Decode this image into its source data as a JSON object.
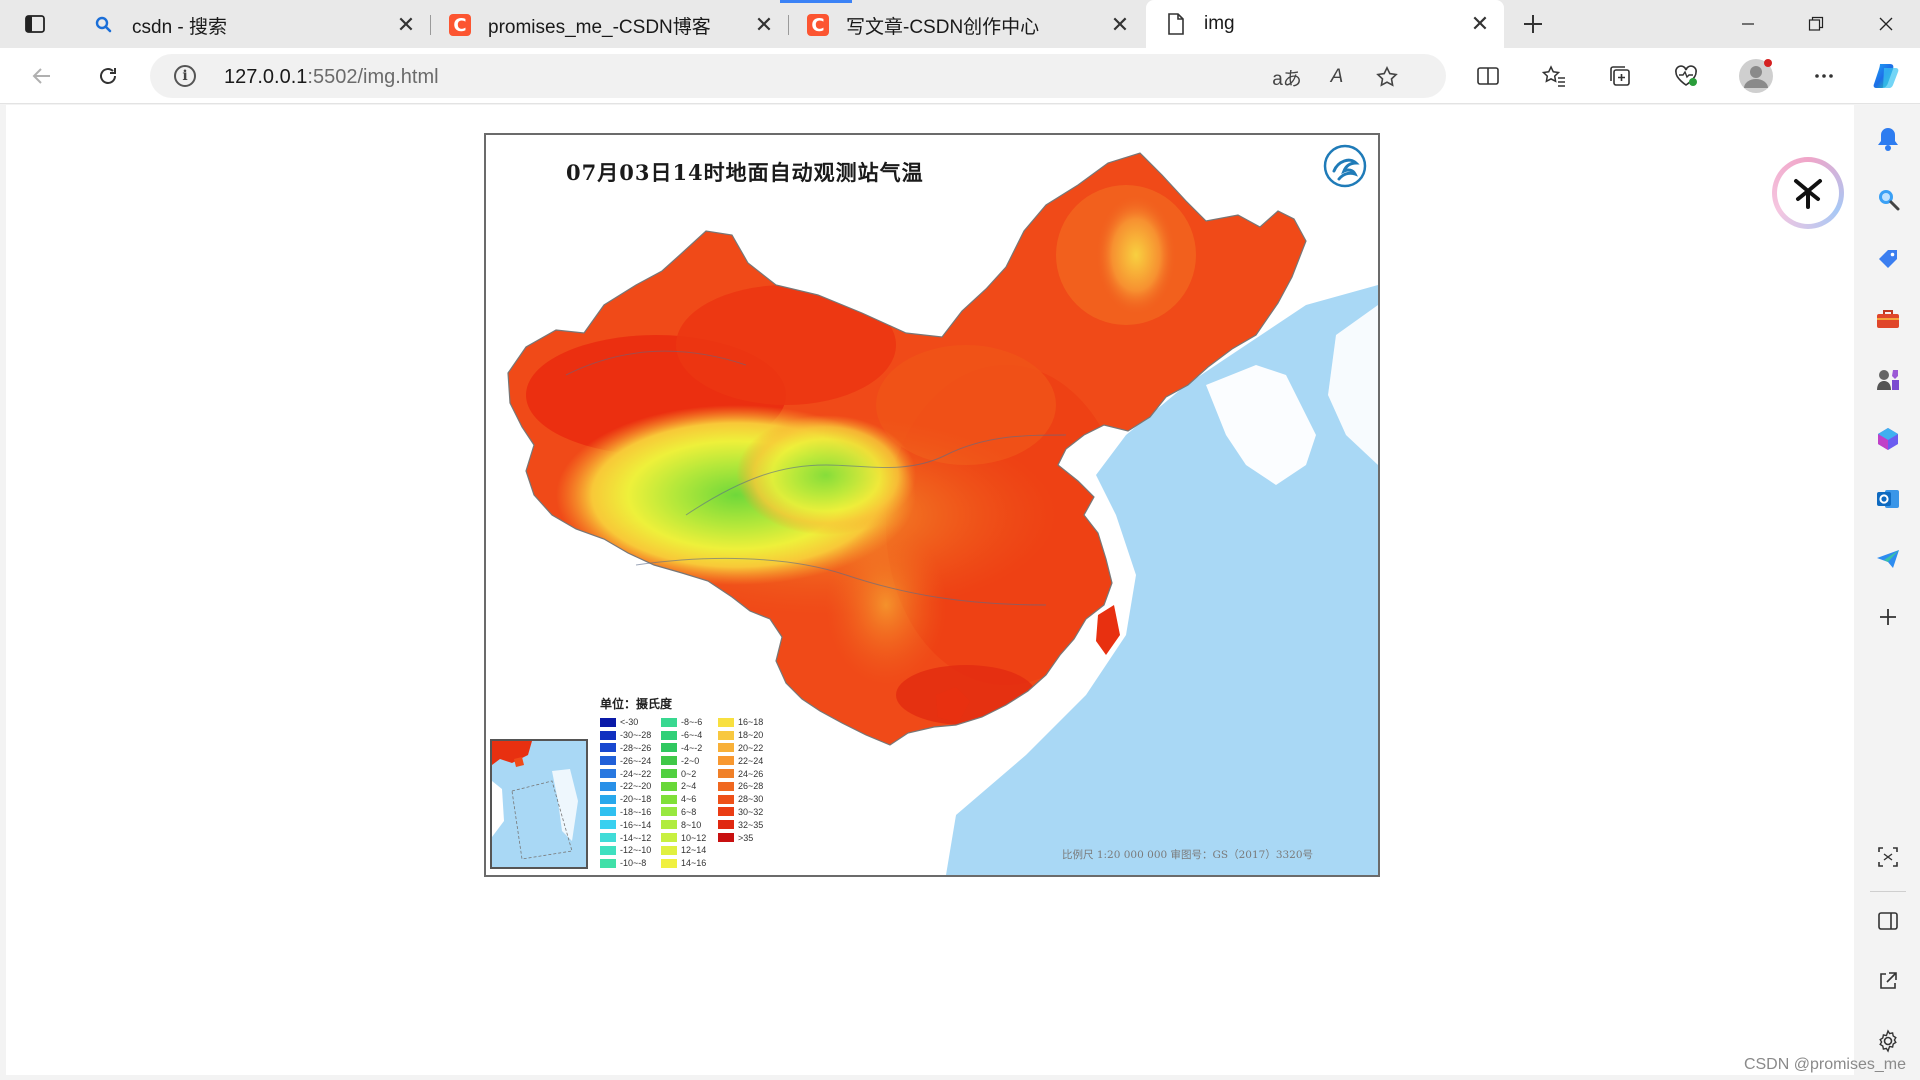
{
  "tabs": [
    {
      "title": "csdn - 搜索",
      "icon": "search-icon"
    },
    {
      "title": "promises_me_-CSDN博客",
      "icon": "csdn-logo-icon"
    },
    {
      "title": "写文章-CSDN创作中心",
      "icon": "csdn-logo-icon"
    },
    {
      "title": "img",
      "icon": "page-icon",
      "active": true
    }
  ],
  "csdn_glyph": "C",
  "address": {
    "host": "127.0.0.1",
    "path": ":5502/img.html",
    "translate_label": "aあ",
    "read_aloud_label": "A"
  },
  "page": {
    "map_title": "07月03日14时地面自动观测站气温",
    "legend_title": "单位：摄氏度",
    "legend": [
      {
        "label": "<-30",
        "color": "#0a1aa8"
      },
      {
        "label": "-30~-28",
        "color": "#1030c0"
      },
      {
        "label": "-28~-26",
        "color": "#1848d0"
      },
      {
        "label": "-26~-24",
        "color": "#2060d8"
      },
      {
        "label": "-24~-22",
        "color": "#2878e0"
      },
      {
        "label": "-22~-20",
        "color": "#2890e8"
      },
      {
        "label": "-20~-18",
        "color": "#28a8ec"
      },
      {
        "label": "-18~-16",
        "color": "#30c0f0"
      },
      {
        "label": "-16~-14",
        "color": "#38d0f0"
      },
      {
        "label": "-14~-12",
        "color": "#40dcd8"
      },
      {
        "label": "-12~-10",
        "color": "#40e0c0"
      },
      {
        "label": "-10~-8",
        "color": "#40e0a8"
      },
      {
        "label": "-8~-6",
        "color": "#38d890"
      },
      {
        "label": "-6~-4",
        "color": "#30d078"
      },
      {
        "label": "-4~-2",
        "color": "#30c860"
      },
      {
        "label": "-2~0",
        "color": "#40c848"
      },
      {
        "label": "0~2",
        "color": "#50d040"
      },
      {
        "label": "2~4",
        "color": "#68d838"
      },
      {
        "label": "4~6",
        "color": "#80e038"
      },
      {
        "label": "6~8",
        "color": "#98e840"
      },
      {
        "label": "8~10",
        "color": "#b0ec40"
      },
      {
        "label": "10~12",
        "color": "#c8f040"
      },
      {
        "label": "12~14",
        "color": "#e0f040"
      },
      {
        "label": "14~16",
        "color": "#f0f040"
      },
      {
        "label": "16~18",
        "color": "#f8e040"
      },
      {
        "label": "18~20",
        "color": "#f8c840"
      },
      {
        "label": "20~22",
        "color": "#f8b038"
      },
      {
        "label": "22~24",
        "color": "#f89830"
      },
      {
        "label": "24~26",
        "color": "#f08028"
      },
      {
        "label": "26~28",
        "color": "#f06820"
      },
      {
        "label": "28~30",
        "color": "#ee5018"
      },
      {
        "label": "30~32",
        "color": "#ea3c14"
      },
      {
        "label": "32~35",
        "color": "#e02810"
      },
      {
        "label": ">35",
        "color": "#c81010"
      }
    ],
    "scale_note": "比例尺 1:20 000 000    审图号：GS（2017）3320号"
  },
  "watermark": "CSDN @promises_me",
  "colors": {
    "accent": "#3b82f6",
    "csdn": "#fc5531",
    "sea": "#a9d8f5"
  }
}
